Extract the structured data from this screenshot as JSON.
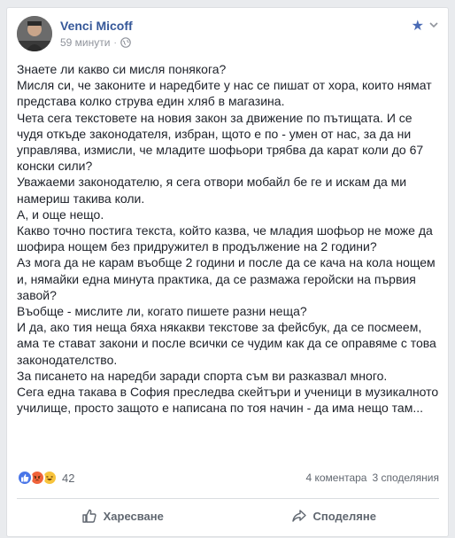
{
  "post": {
    "author": "Venci Micoff",
    "time": "59 минути",
    "separator": "·",
    "paragraphs": [
      "Знаете ли какво си мисля понякога?",
      "Мисля си, че законите и наредбите у нас се пишат от хора, които нямат представа колко струва един хляб в магазина.",
      "Чета сега текстовете на новия закон за движение по пътищата. И се чудя откъде законодателя, избран, щото е по - умен от нас, за да ни управлява, измисли, че младите шофьори трябва да карат коли до 67 конски сили?",
      "Уважаеми законодателю, я сега отвори мобайл бе ге и искам да ми намериш такива коли.",
      "А, и още нещо.",
      "Какво точно постига текста, който казва, че младия шофьор не може да шофира нощем без придружител в продължение на 2 години?",
      "Аз мога да не карам въобще 2 години и после да се кача на кола нощем и, нямайки една минута практика, да се размажа геройски на първия завой?",
      "Въобще - мислите ли, когато пишете разни неща?",
      "И да, ако тия неща бяха някакви текстове за фейсбук, да се посмеем, ама те стават закони и после всички се чудим как да се оправяме с това законодателство.",
      "За писането на наредби заради спорта съм ви разказвал много.",
      "Сега една такава в София преследва скейтъри и ученици в музикалното училище, просто защото е написана по тоя начин - да има нещо там..."
    ],
    "reaction_count": "42",
    "comments": "4 коментара",
    "shares": "3 споделяния"
  },
  "actions": {
    "like": "Харесване",
    "share": "Споделяне"
  },
  "icons": {
    "star": "star-icon",
    "globe": "globe-icon",
    "chevron": "chevron-down-icon",
    "like": "thumbs-up-icon",
    "share": "share-arrow-icon"
  },
  "colors": {
    "author": "#365899",
    "accent": "#4a6bb5",
    "like_reaction": "#4a76e8",
    "angry_reaction": "#f0633b",
    "haha_reaction": "#f7c33b"
  }
}
